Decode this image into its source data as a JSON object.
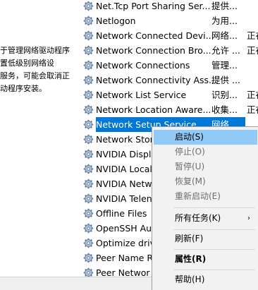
{
  "description_panel": {
    "lines": [
      "于管理网络驱动程序",
      "置低级别网络设",
      "服务，可能会取消正",
      "动程序安装。"
    ]
  },
  "services": [
    {
      "name": "Net.Tcp Port Sharing Ser...",
      "desc": "提供...",
      "status": ""
    },
    {
      "name": "Netlogon",
      "desc": "为用...",
      "status": ""
    },
    {
      "name": "Network Connected Devi...",
      "desc": "网络...",
      "status": "正在"
    },
    {
      "name": "Network Connection Bro...",
      "desc": "允许 ...",
      "status": "正在"
    },
    {
      "name": "Network Connections",
      "desc": "管理...",
      "status": ""
    },
    {
      "name": "Network Connectivity Ass...",
      "desc": "提供 ...",
      "status": ""
    },
    {
      "name": "Network List Service",
      "desc": "识别...",
      "status": "正在"
    },
    {
      "name": "Network Location Aware...",
      "desc": "收集...",
      "status": "正在"
    },
    {
      "name": "Network Setup Service",
      "desc": "网络...",
      "status": ""
    },
    {
      "name": "Network Stor",
      "desc": "",
      "status": ""
    },
    {
      "name": "NVIDIA Displ",
      "desc": "",
      "status": ""
    },
    {
      "name": "NVIDIA Local",
      "desc": "",
      "status": ""
    },
    {
      "name": "NVIDIA Netw",
      "desc": "",
      "status": ""
    },
    {
      "name": "NVIDIA Telen",
      "desc": "",
      "status": ""
    },
    {
      "name": "Offline Files",
      "desc": "",
      "status": ""
    },
    {
      "name": "OpenSSH Aut",
      "desc": "",
      "status": ""
    },
    {
      "name": "Optimize driv",
      "desc": "",
      "status": ""
    },
    {
      "name": "Peer Name R",
      "desc": "",
      "status": ""
    },
    {
      "name": "Peer Networ",
      "desc": "",
      "status": ""
    }
  ],
  "context_menu": {
    "start": "启动(S)",
    "stop": "停止(O)",
    "pause": "暂停(U)",
    "resume": "恢复(M)",
    "restart": "重新启动(E)",
    "all_tasks": "所有任务(K)",
    "refresh": "刷新(F)",
    "properties": "属性(R)",
    "help": "帮助(H)"
  },
  "colors": {
    "selection": "#0078d7",
    "menu_hover": "#91c9f7",
    "menu_bg": "#f2f2f2"
  }
}
